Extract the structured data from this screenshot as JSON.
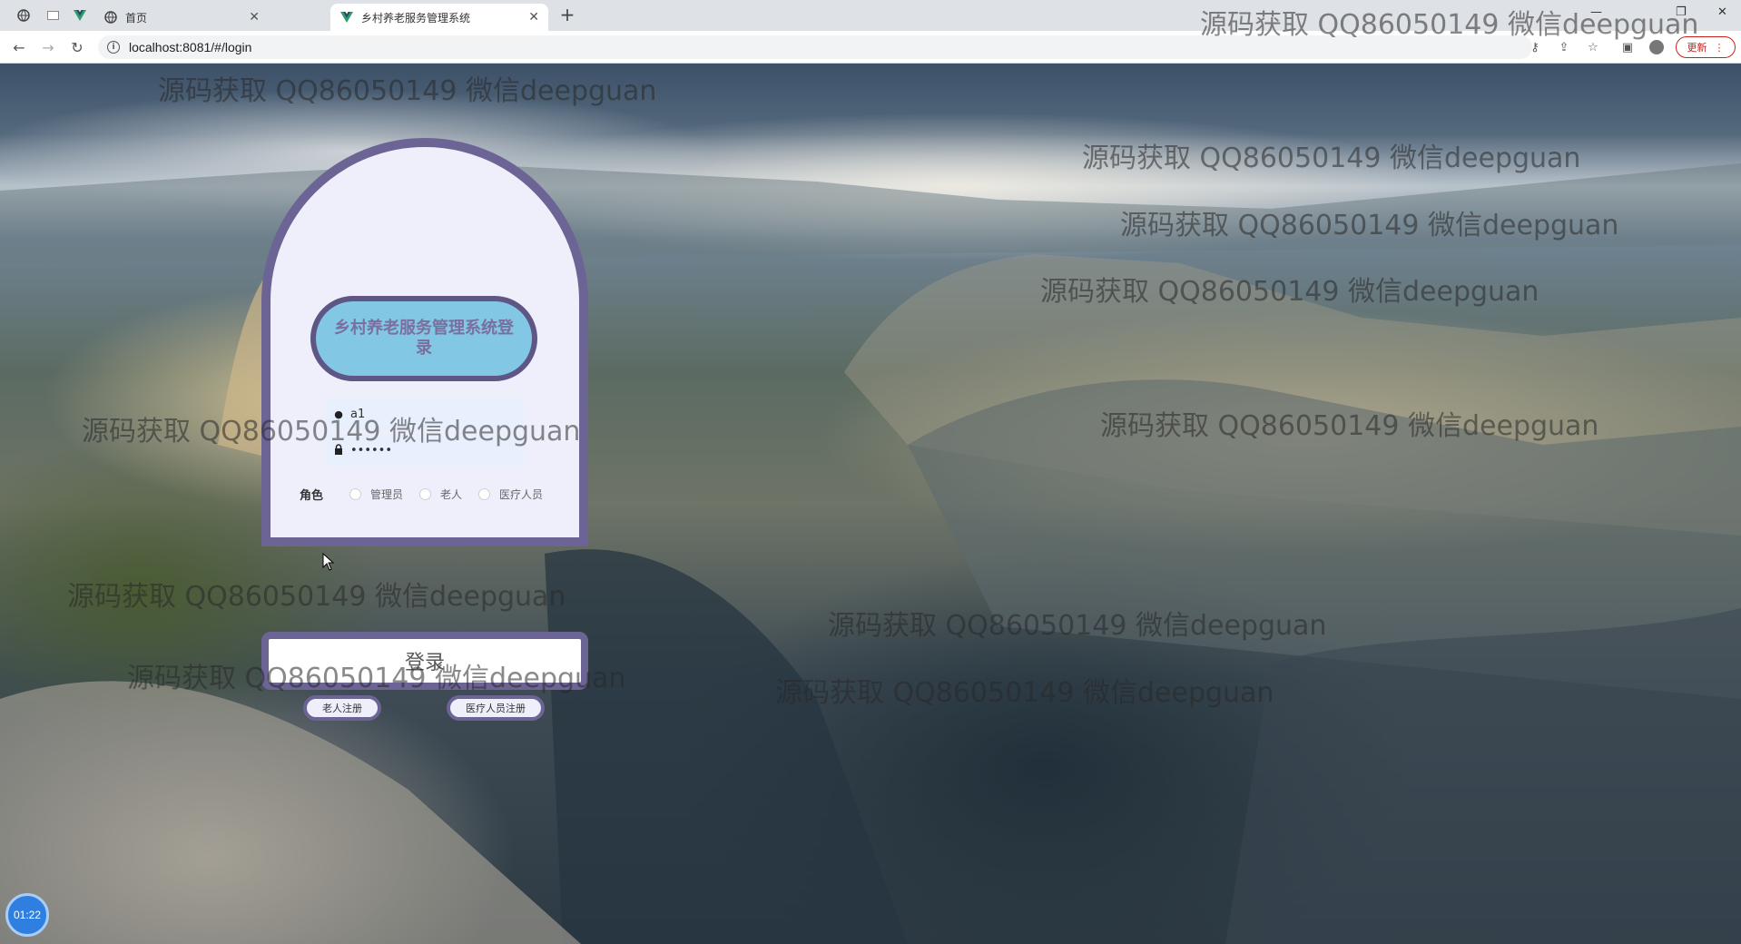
{
  "browser": {
    "tabs": [
      {
        "title": "首页",
        "active": false
      },
      {
        "title": "乡村养老服务管理系统",
        "active": true
      }
    ],
    "url": "localhost:8081/#/login",
    "update_label": "更新"
  },
  "login": {
    "title": "乡村养老服务管理系统登录",
    "username_value": "a1",
    "password_value": "••••••",
    "role_label": "角色",
    "roles": [
      "管理员",
      "老人",
      "医疗人员"
    ],
    "submit_label": "登录",
    "register_elder_label": "老人注册",
    "register_medic_label": "医疗人员注册"
  },
  "watermark": "源码获取 QQ86050149 微信deepguan",
  "timer": "01:22",
  "colors": {
    "card_border": "#6c6494",
    "card_bg": "#efeffc",
    "title_bg": "#82c7e4",
    "title_text": "#7a6f9e"
  }
}
